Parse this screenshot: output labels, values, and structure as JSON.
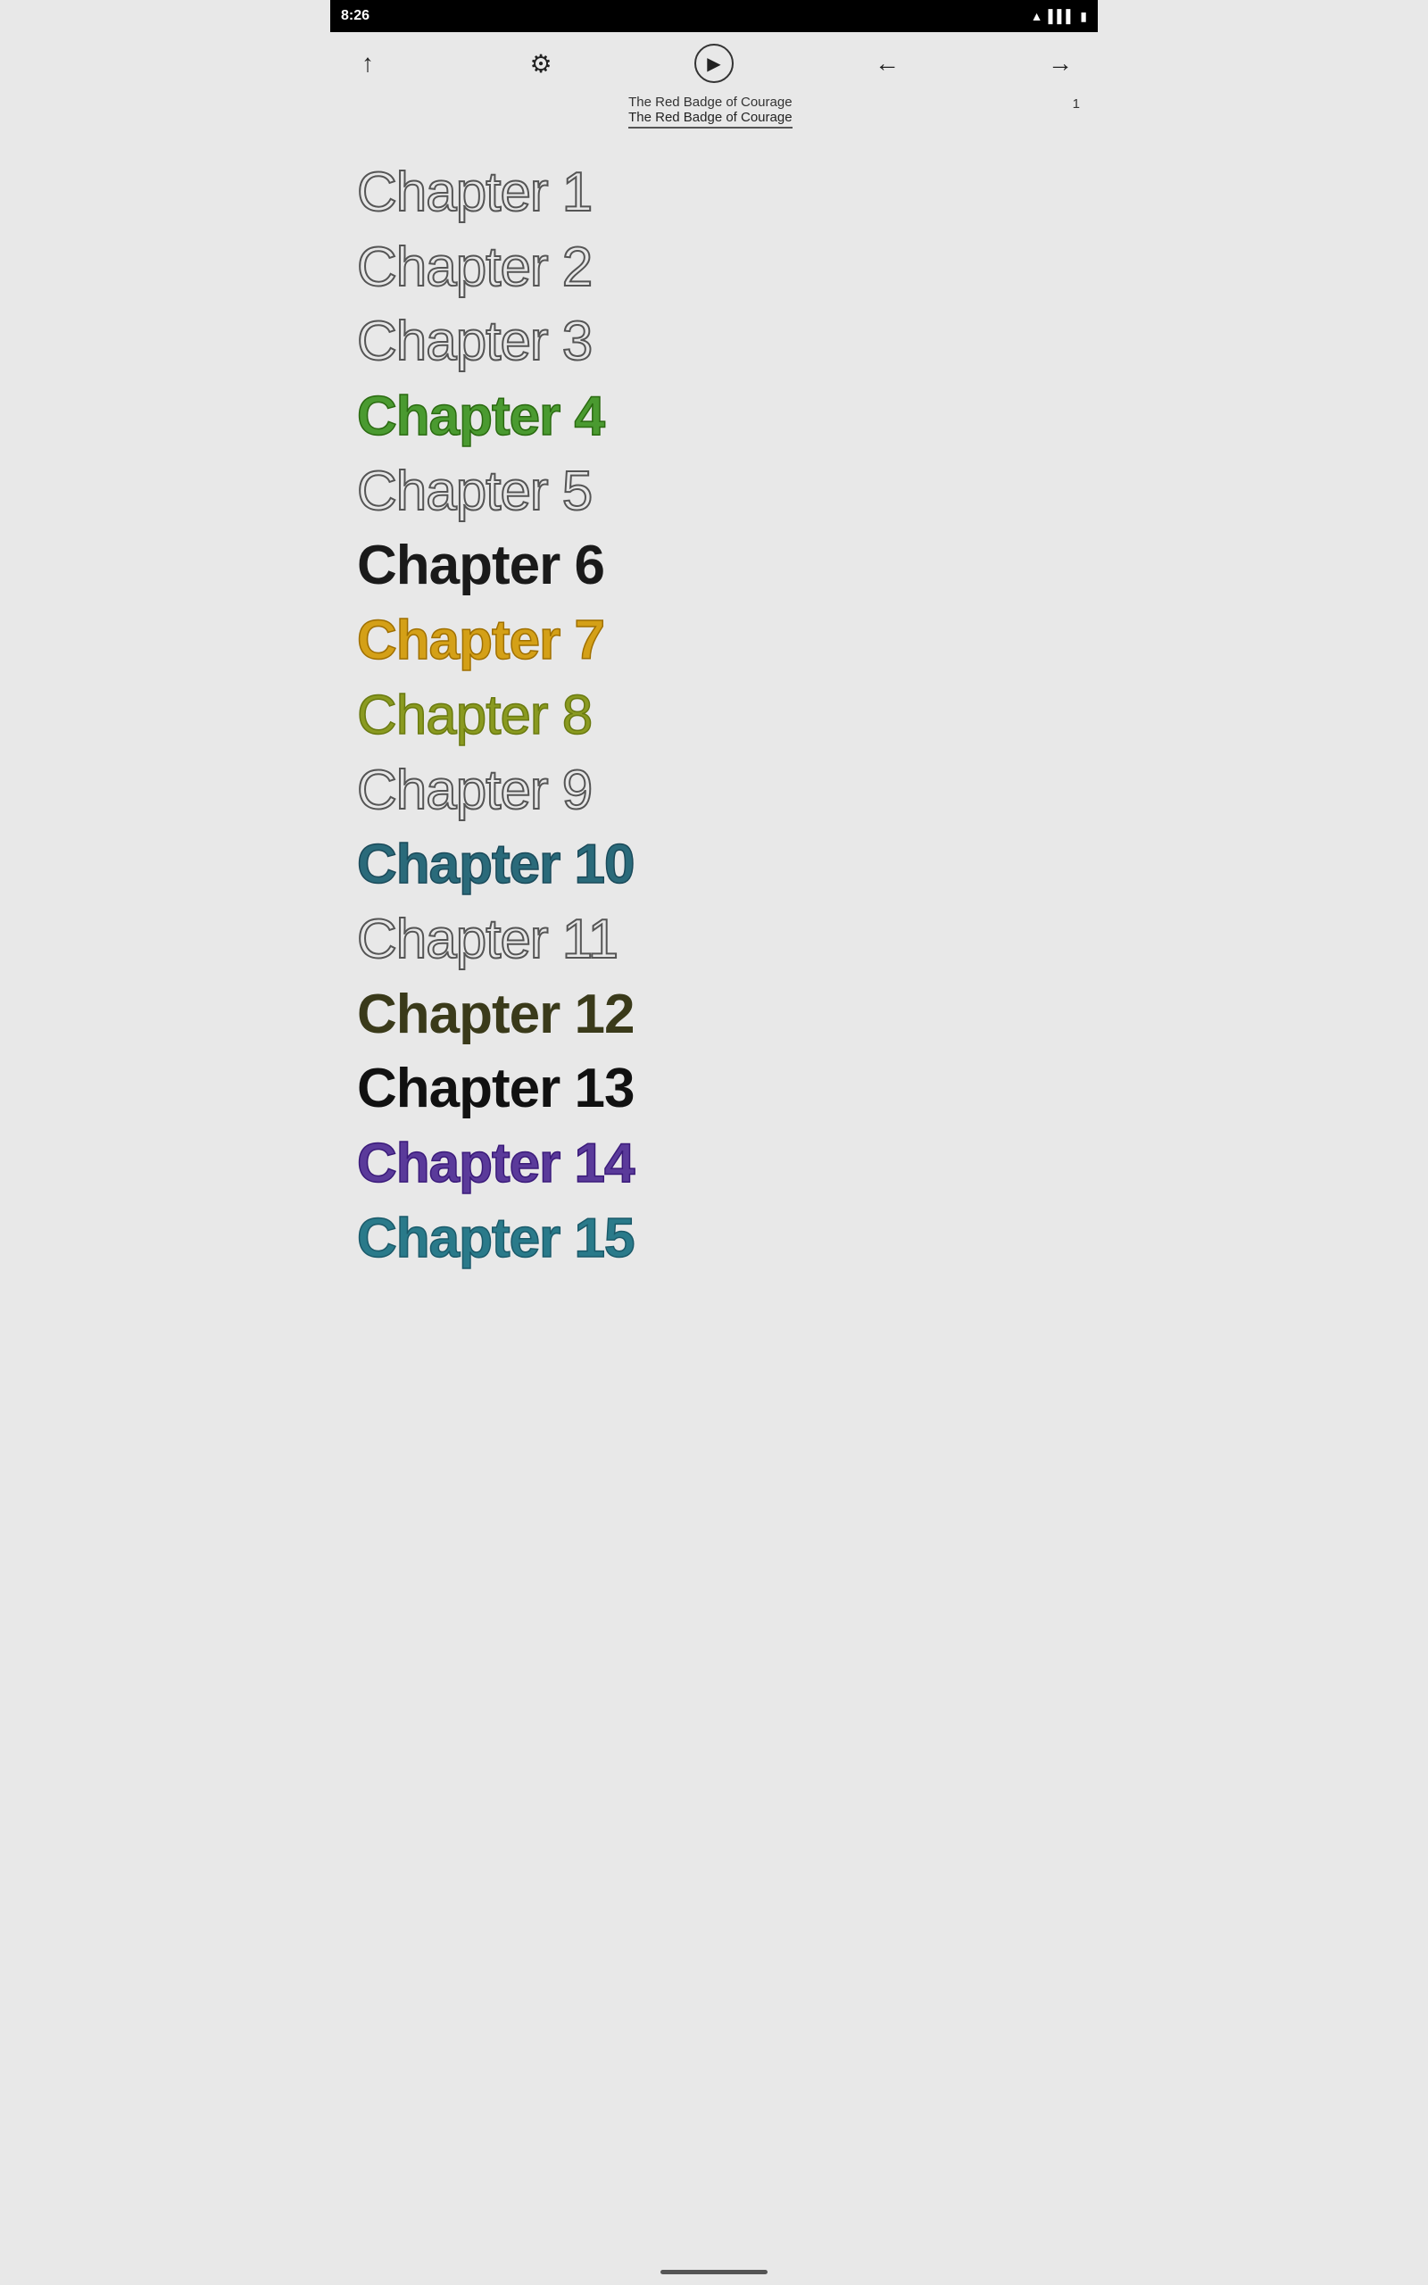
{
  "statusBar": {
    "time": "8:26",
    "icons": [
      "wifi",
      "battery"
    ]
  },
  "toolbar": {
    "upArrow": "↑",
    "settings": "⚙",
    "play": "▶",
    "back": "←",
    "forward": "→"
  },
  "header": {
    "title": "The Red Badge of Courage",
    "subtitle": "The Red Badge of Courage",
    "pageNumber": "1"
  },
  "chapters": [
    {
      "label": "Chapter 1",
      "style": "outline"
    },
    {
      "label": "Chapter 2",
      "style": "outline"
    },
    {
      "label": "Chapter 3",
      "style": "outline"
    },
    {
      "label": "Chapter 4",
      "style": "green"
    },
    {
      "label": "Chapter 5",
      "style": "outline"
    },
    {
      "label": "Chapter 6",
      "style": "dark-bold"
    },
    {
      "label": "Chapter 7",
      "style": "yellow"
    },
    {
      "label": "Chapter 8",
      "style": "olive"
    },
    {
      "label": "Chapter 9",
      "style": "outline"
    },
    {
      "label": "Chapter 10",
      "style": "teal"
    },
    {
      "label": "Chapter 11",
      "style": "outline"
    },
    {
      "label": "Chapter 12",
      "style": "dark-olive"
    },
    {
      "label": "Chapter 13",
      "style": "very-dark-bold"
    },
    {
      "label": "Chapter 14",
      "style": "purple"
    },
    {
      "label": "Chapter 15",
      "style": "teal-light"
    }
  ]
}
